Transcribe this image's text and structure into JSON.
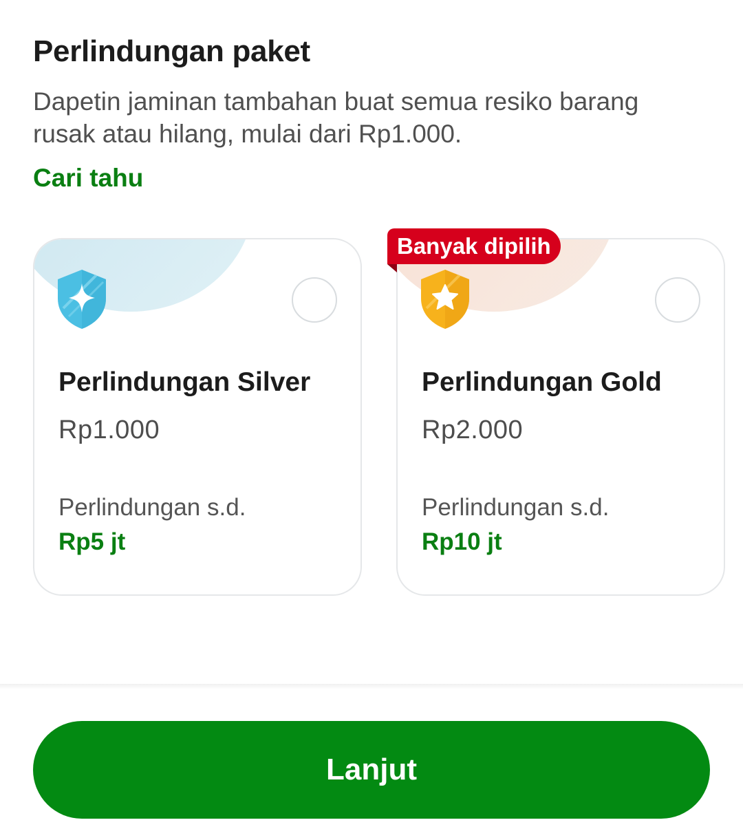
{
  "header": {
    "title": "Perlindungan paket",
    "description": "Dapetin jaminan tambahan buat semua resiko barang rusak atau hilang, mulai dari Rp1.000.",
    "learn_more": "Cari tahu"
  },
  "plans": [
    {
      "name": "Perlindungan Silver",
      "price": "Rp1.000",
      "coverage_label": "Perlindungan s.d.",
      "coverage_value": "Rp5 jt",
      "icon": "silver-shield-sparkle-icon",
      "selected": false
    },
    {
      "name": "Perlindungan Gold",
      "price": "Rp2.000",
      "coverage_label": "Perlindungan s.d.",
      "coverage_value": "Rp10 jt",
      "icon": "gold-shield-star-icon",
      "badge": "Banyak dipilih",
      "selected": false
    }
  ],
  "footer": {
    "cta_label": "Lanjut"
  },
  "colors": {
    "accent_green": "#038a12",
    "link_green": "#0a7f12",
    "badge_red": "#d6001c",
    "silver_shield": "#4bbfe3",
    "gold_shield": "#f7b21c"
  }
}
